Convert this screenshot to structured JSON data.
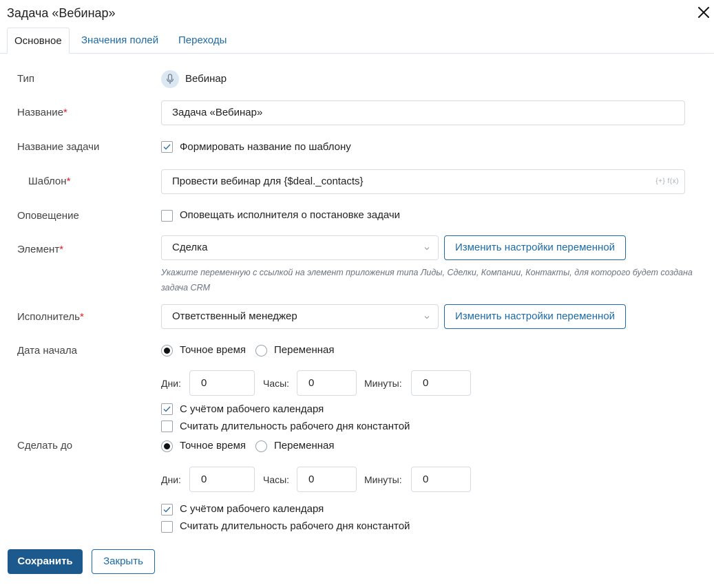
{
  "dialog": {
    "title": "Задача «Вебинар»"
  },
  "tabs": [
    {
      "label": "Основное"
    },
    {
      "label": "Значения полей"
    },
    {
      "label": "Переходы"
    }
  ],
  "form": {
    "type": {
      "label": "Тип",
      "value": "Вебинар",
      "icon": "microphone-icon"
    },
    "name": {
      "label": "Название",
      "required_mark": "*",
      "value": "Задача «Вебинар»"
    },
    "task_name": {
      "label": "Название задачи",
      "checkbox_label": "Формировать название по шаблону",
      "checked": true
    },
    "template": {
      "label": "Шаблон",
      "required_mark": "*",
      "value": "Провести вебинар для {$deal._contacts}",
      "hint_icons": "{+} f(x)"
    },
    "notify": {
      "label": "Оповещение",
      "checkbox_label": "Оповещать исполнителя о постановке задачи",
      "checked": false
    },
    "element": {
      "label": "Элемент",
      "required_mark": "*",
      "value": "Сделка",
      "button": "Изменить настройки переменной",
      "hint": "Укажите переменную с ссылкой на элемент приложения типа Лиды, Сделки, Компании, Контакты, для которого будет создана задача CRM"
    },
    "assignee": {
      "label": "Исполнитель",
      "required_mark": "*",
      "value": "Ответственный менеджер",
      "button": "Изменить настройки переменной"
    },
    "start_date": {
      "label": "Дата начала",
      "radio_exact": "Точное время",
      "radio_variable": "Переменная",
      "selected": "exact",
      "days_label": "Дни:",
      "days": "0",
      "hours_label": "Часы:",
      "hours": "0",
      "minutes_label": "Минуты:",
      "minutes": "0",
      "calendar_label": "С учётом рабочего календаря",
      "calendar_checked": true,
      "constant_label": "Считать длительность рабочего дня константой",
      "constant_checked": false
    },
    "due_date": {
      "label": "Сделать до",
      "radio_exact": "Точное время",
      "radio_variable": "Переменная",
      "selected": "exact",
      "days_label": "Дни:",
      "days": "0",
      "hours_label": "Часы:",
      "hours": "0",
      "minutes_label": "Минуты:",
      "minutes": "0",
      "calendar_label": "С учётом рабочего календаря",
      "calendar_checked": true,
      "constant_label": "Считать длительность рабочего дня константой",
      "constant_checked": false
    }
  },
  "footer": {
    "save": "Сохранить",
    "close": "Закрыть"
  },
  "colors": {
    "accent": "#1d6ba6",
    "primary_button": "#1c5a8e",
    "required": "#d9222a"
  }
}
